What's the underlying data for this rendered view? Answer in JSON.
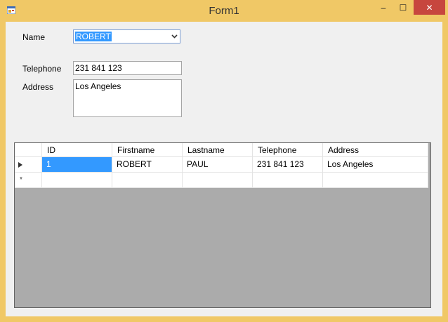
{
  "window": {
    "title": "Form1"
  },
  "controls": {
    "minimize": "–",
    "maximize": "☐",
    "close": "✕"
  },
  "form": {
    "name_label": "Name",
    "name_value": "ROBERT",
    "telephone_label": "Telephone",
    "telephone_value": "231 841 123",
    "address_label": "Address",
    "address_value": "Los Angeles"
  },
  "grid": {
    "columns": [
      "ID",
      "Firstname",
      "Lastname",
      "Telephone",
      "Address"
    ],
    "rows": [
      [
        "1",
        "ROBERT",
        "PAUL",
        "231 841 123",
        "Los Angeles"
      ]
    ],
    "new_row_marker": "*"
  },
  "colors": {
    "title_bar": "#f0c866",
    "selection": "#3399ff",
    "close_button": "#c7463e",
    "grid_background": "#ababab"
  },
  "icons": {
    "app": "form-app-icon",
    "dropdown": "chevron-down-icon",
    "current_row": "row-pointer-icon"
  }
}
